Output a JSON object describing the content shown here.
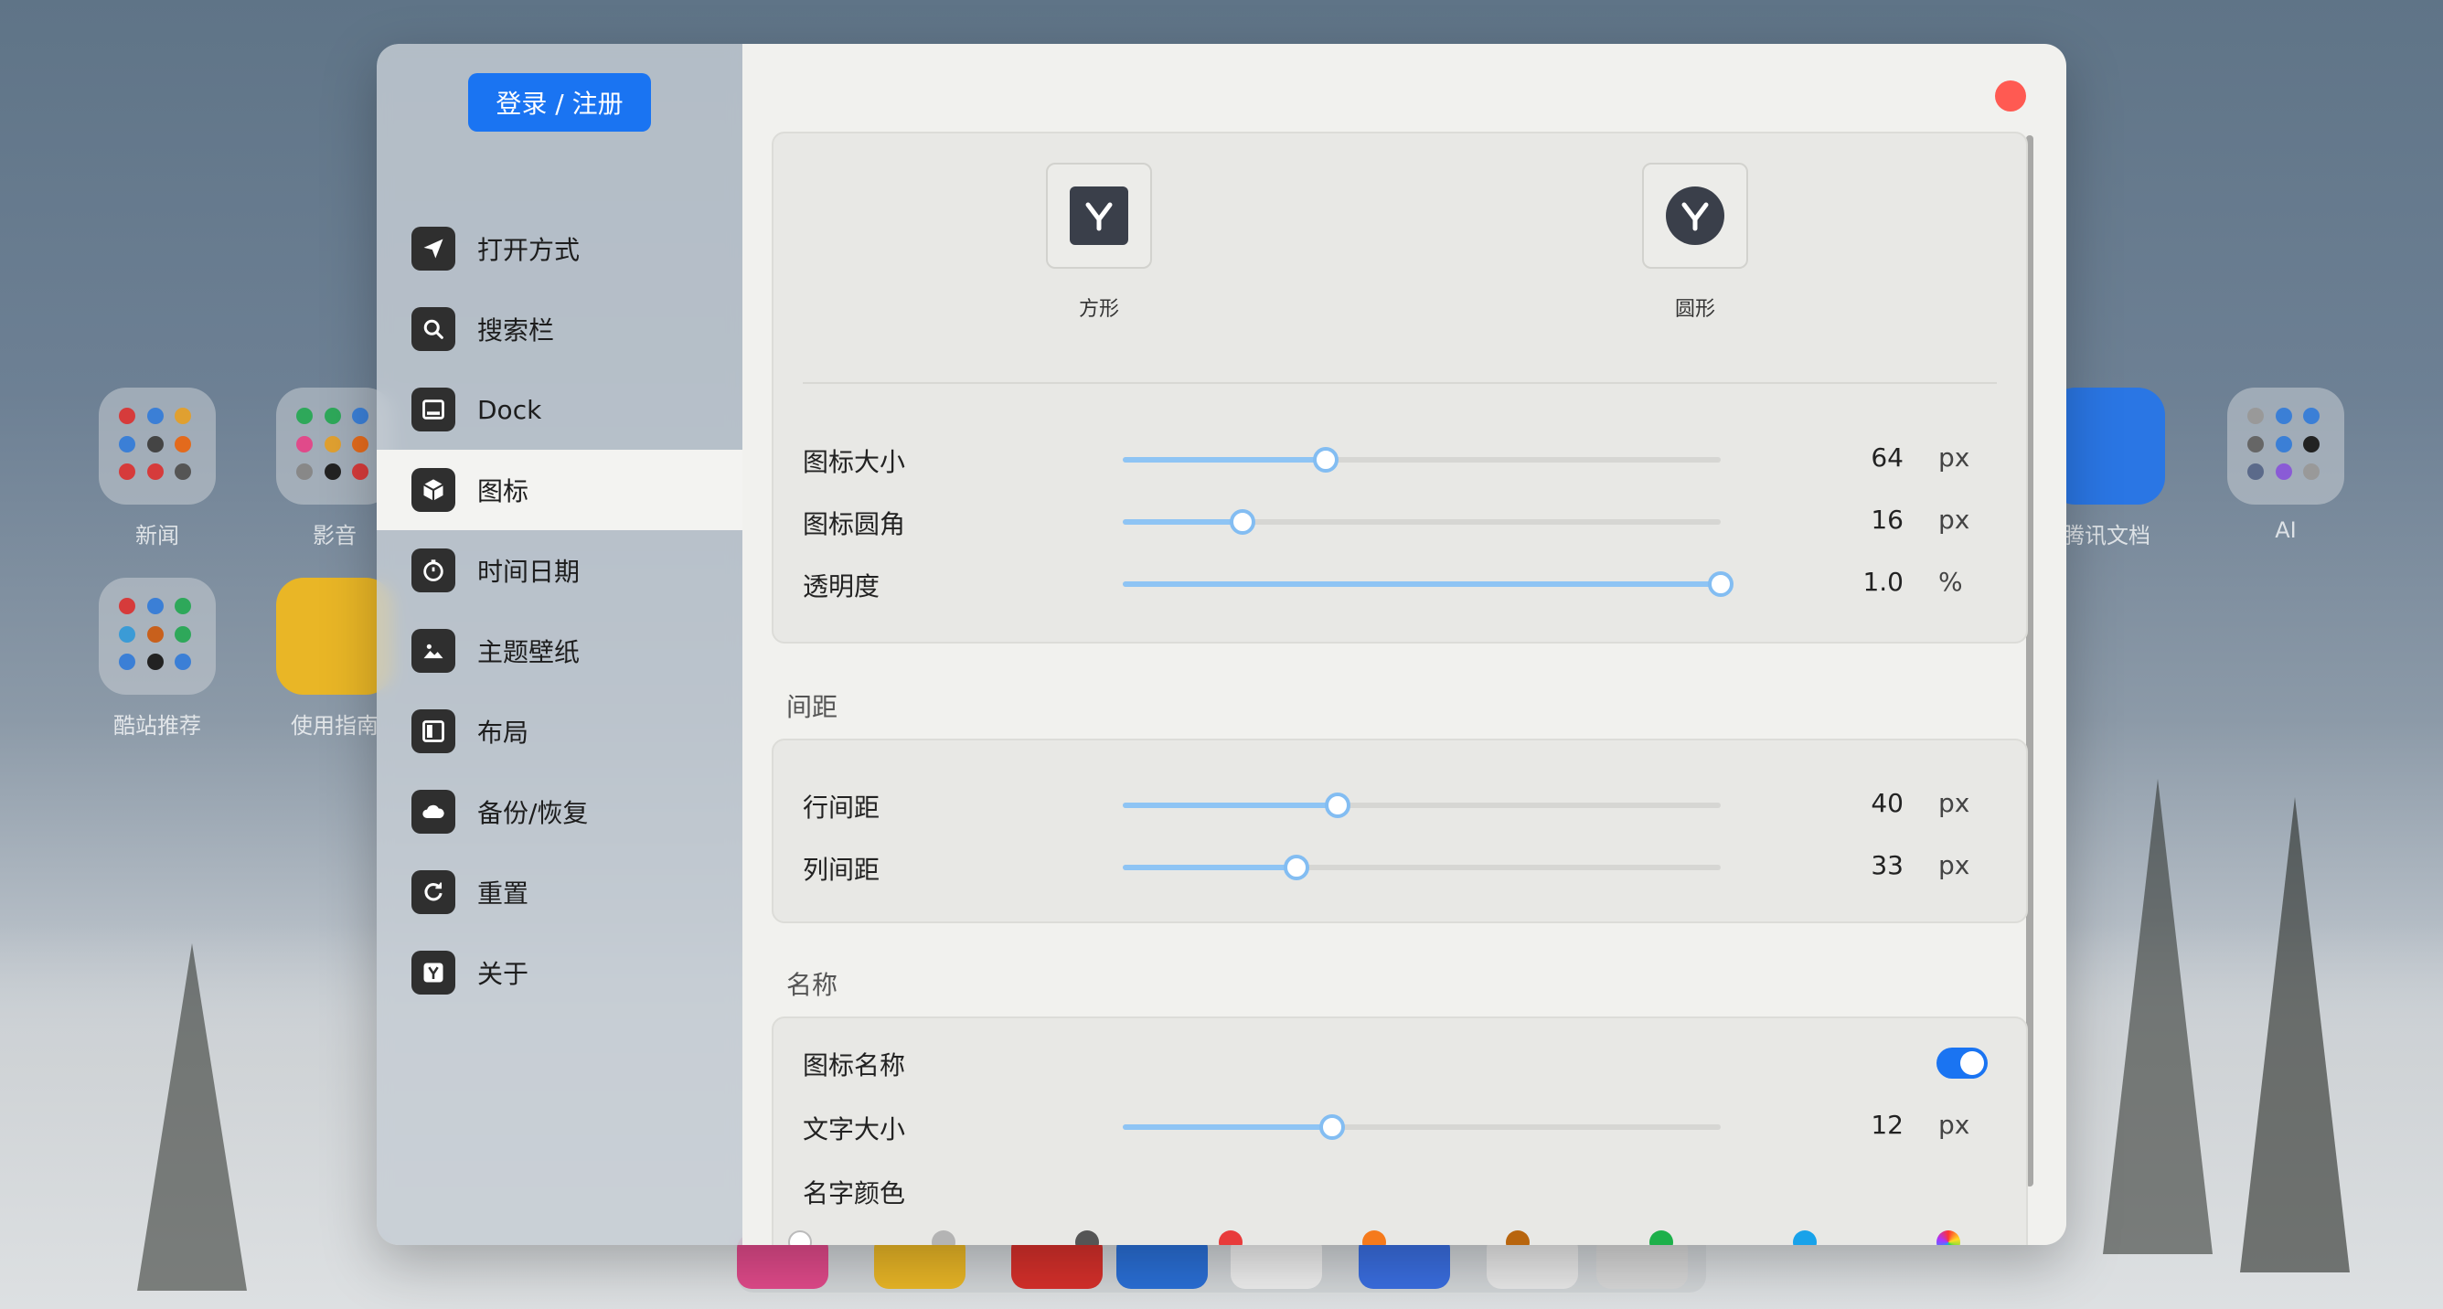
{
  "desktop": {
    "icons": [
      {
        "label": "新闻"
      },
      {
        "label": "影音"
      },
      {
        "label": "酷站推荐"
      },
      {
        "label": "使用指南"
      },
      {
        "label": "腾讯文档"
      },
      {
        "label": "AI"
      }
    ]
  },
  "sidebar": {
    "login_label": "登录 / 注册",
    "items": [
      {
        "label": "打开方式",
        "icon": "paper-plane-icon"
      },
      {
        "label": "搜索栏",
        "icon": "search-icon"
      },
      {
        "label": "Dock",
        "icon": "dock-icon"
      },
      {
        "label": "图标",
        "icon": "cube-icon",
        "active": true
      },
      {
        "label": "时间日期",
        "icon": "stopwatch-icon"
      },
      {
        "label": "主题壁纸",
        "icon": "image-icon"
      },
      {
        "label": "布局",
        "icon": "layout-icon"
      },
      {
        "label": "备份/恢复",
        "icon": "cloud-icon"
      },
      {
        "label": "重置",
        "icon": "reset-icon"
      },
      {
        "label": "关于",
        "icon": "logo-icon"
      }
    ]
  },
  "icon_settings": {
    "shapes": [
      {
        "label": "方形"
      },
      {
        "label": "圆形"
      }
    ],
    "rows": [
      {
        "label": "图标大小",
        "value": "64",
        "unit": "px",
        "fraction": 0.34
      },
      {
        "label": "图标圆角",
        "value": "16",
        "unit": "px",
        "fraction": 0.2
      },
      {
        "label": "透明度",
        "value": "1.0",
        "unit": "%",
        "fraction": 1.0
      }
    ]
  },
  "spacing": {
    "title": "间距",
    "rows": [
      {
        "label": "行间距",
        "value": "40",
        "unit": "px",
        "fraction": 0.36
      },
      {
        "label": "列间距",
        "value": "33",
        "unit": "px",
        "fraction": 0.29
      }
    ]
  },
  "name": {
    "title": "名称",
    "show_label": "图标名称",
    "show_enabled": true,
    "font_row": {
      "label": "文字大小",
      "value": "12",
      "unit": "px",
      "fraction": 0.35
    },
    "color_label": "名字颜色",
    "colors": [
      "#ffffff",
      "#b4b4b4",
      "#555555",
      "#e83b3b",
      "#f57a1c",
      "#b8650e",
      "#1db04a",
      "#18a2ea",
      "rainbow"
    ]
  },
  "colors": {
    "accent": "#1a74f2",
    "close": "#ff5a52"
  }
}
